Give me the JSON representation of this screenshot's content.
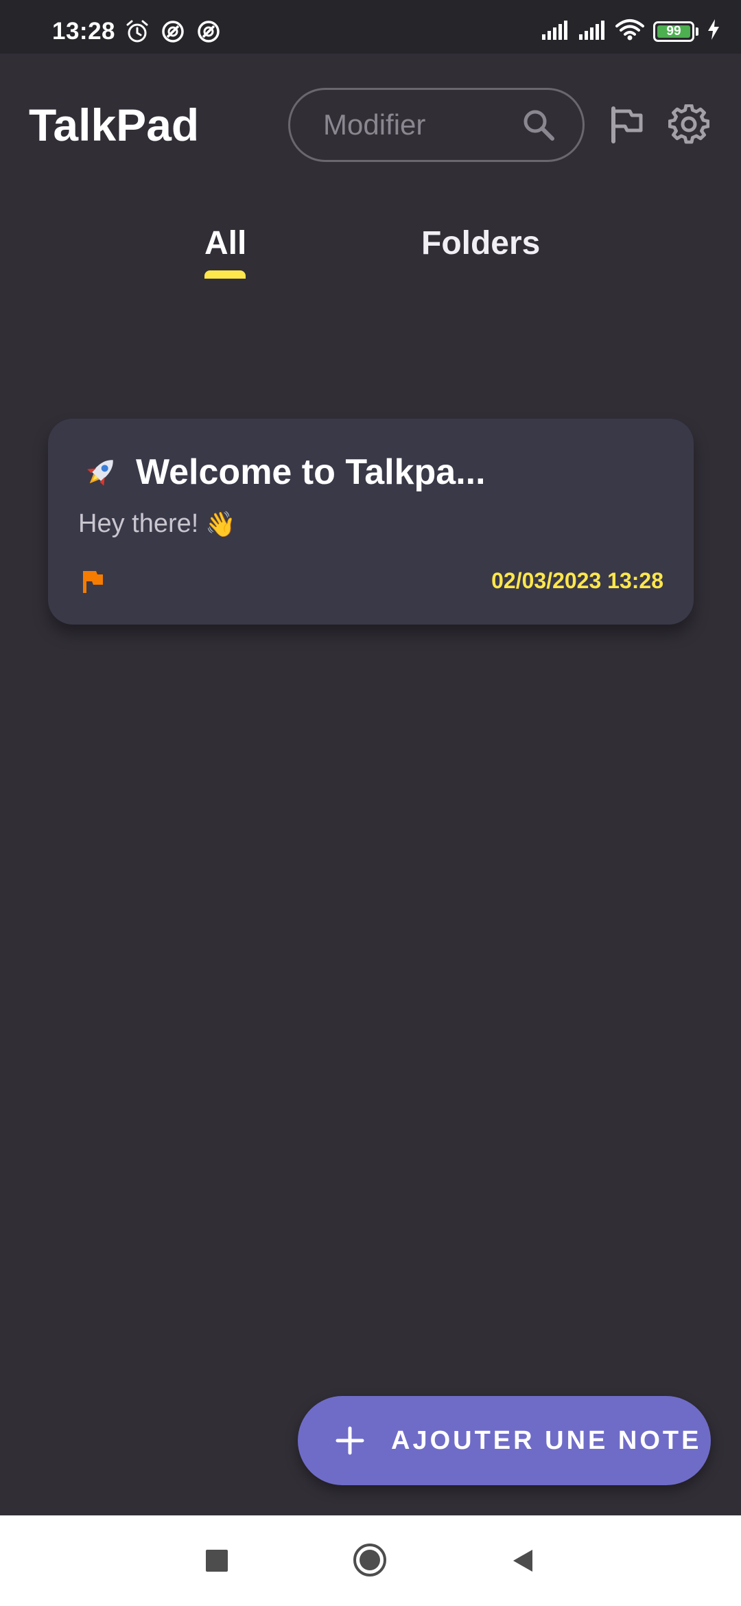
{
  "status_bar": {
    "time": "13:28",
    "battery_level": "99",
    "icons": [
      "alarm-icon",
      "do-not-disturb-icon",
      "do-not-disturb-icon",
      "signal-icon",
      "signal-icon",
      "wifi-icon",
      "battery-icon",
      "charging-icon"
    ]
  },
  "header": {
    "title": "TalkPad",
    "search_placeholder": "Modifier",
    "icons": [
      "search-icon",
      "flag-icon",
      "gear-icon"
    ]
  },
  "tabs": [
    {
      "label": "All",
      "active": true
    },
    {
      "label": "Folders",
      "active": false
    }
  ],
  "notes": [
    {
      "title": "Welcome to Talkpa...",
      "preview": "Hey there!",
      "preview_emoji": "👋",
      "title_icon": "rocket-icon",
      "flag_icon": "flag-icon",
      "date": "02/03/2023 13:28"
    }
  ],
  "fab": {
    "label": "AJOUTER UNE NOTE",
    "icon": "plus-icon"
  },
  "nav_bar": {
    "buttons": [
      "recents-button",
      "home-button",
      "back-button"
    ]
  },
  "colors": {
    "background": "#312e36",
    "status_bar": "#26252a",
    "card": "#3a3948",
    "accent_yellow": "#fde74c",
    "flag_orange": "#f57c00",
    "fab": "#6f6cc8",
    "battery_green": "#4caf50"
  }
}
